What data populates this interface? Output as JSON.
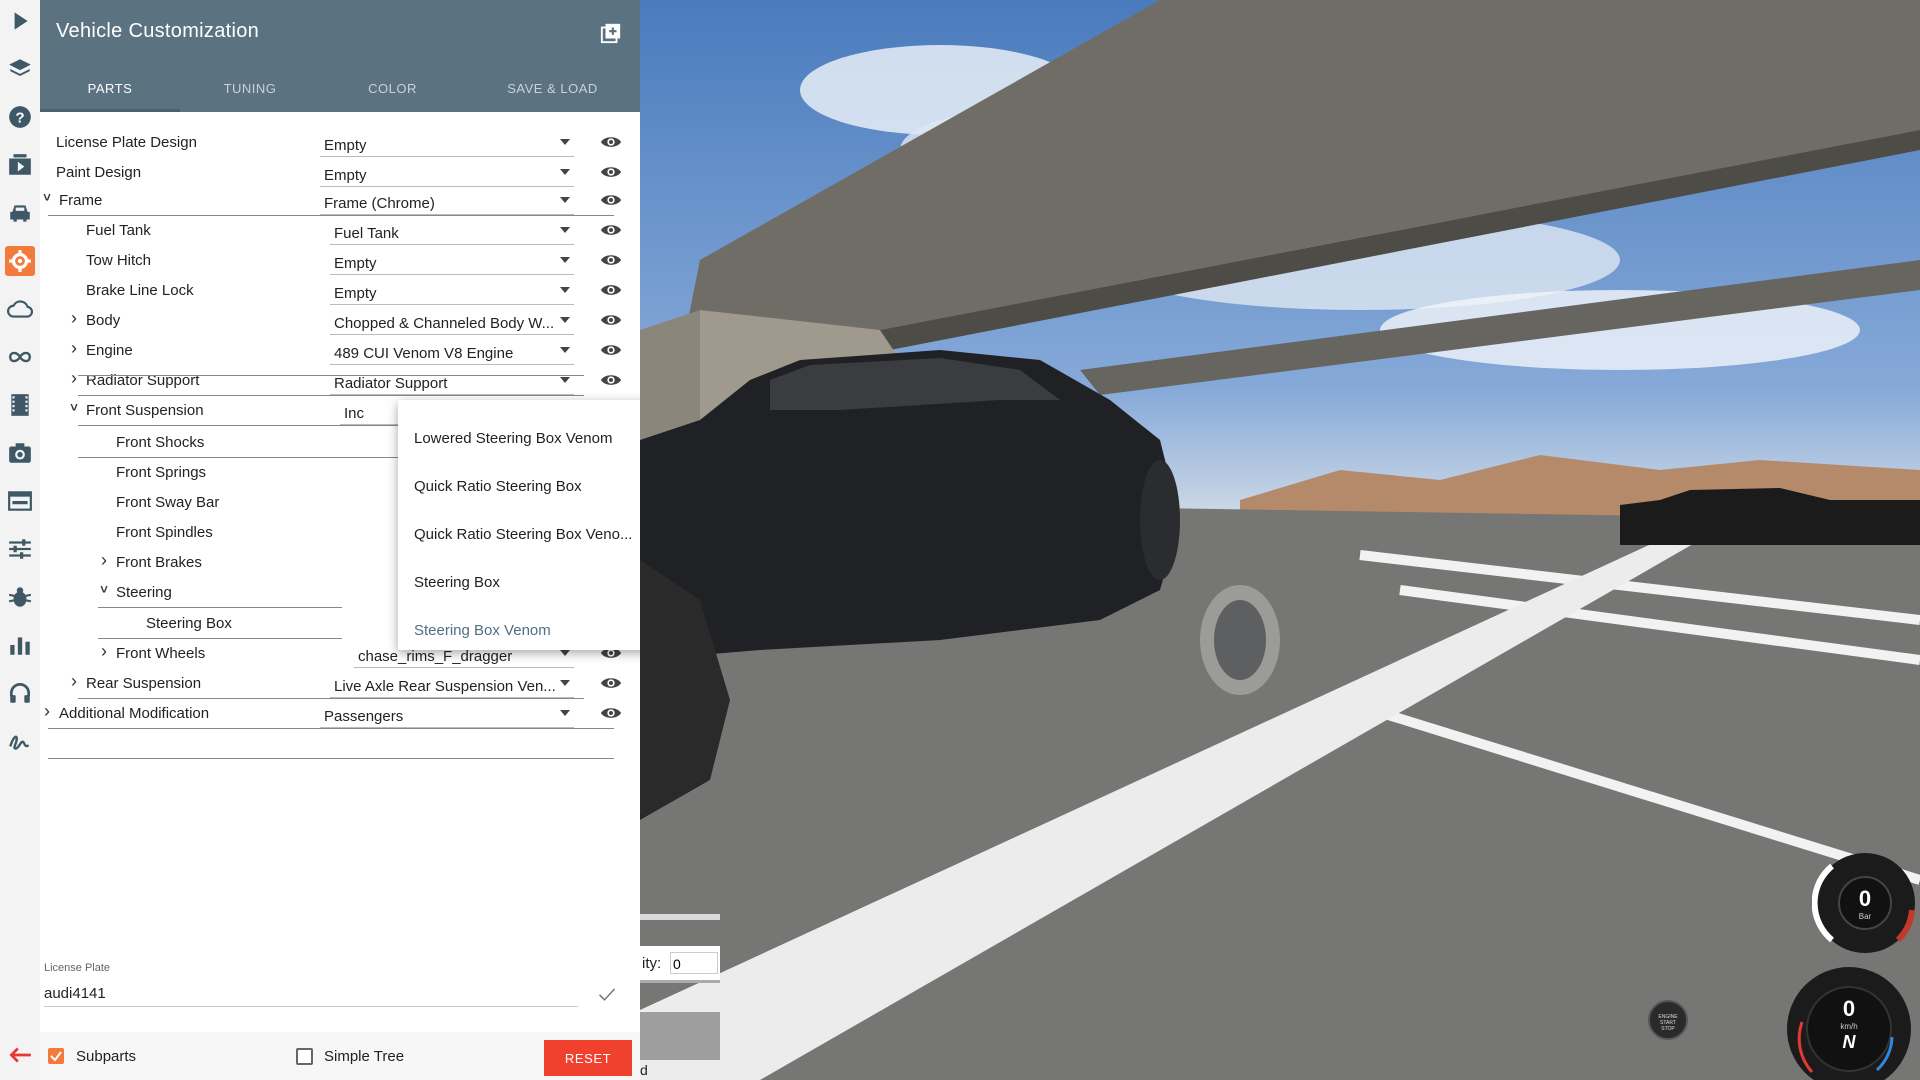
{
  "sidebar": {
    "icons": [
      "play-icon",
      "layers-icon",
      "help-icon",
      "replay-icon",
      "car-icon",
      "gear-icon",
      "cloud-icon",
      "infinity-icon",
      "film-icon",
      "camera-icon",
      "window-icon",
      "sliders-icon",
      "bug-icon",
      "chart-icon",
      "headset-icon",
      "signature-icon",
      "back-arrow-icon"
    ],
    "active_icon": "gear-icon"
  },
  "header": {
    "title": "Vehicle Customization",
    "tabs": [
      {
        "label": "PARTS",
        "active": true
      },
      {
        "label": "TUNING",
        "active": false
      },
      {
        "label": "COLOR",
        "active": false
      },
      {
        "label": "SAVE & LOAD",
        "active": false
      }
    ]
  },
  "parts": [
    {
      "name": "License Plate Design",
      "value": "Empty",
      "level": 0,
      "expander": "none"
    },
    {
      "name": "Paint Design",
      "value": "Empty",
      "level": 0,
      "expander": "none"
    },
    {
      "name": "Frame",
      "value": "Frame (Chrome)",
      "level": 0,
      "expander": "open"
    },
    {
      "name": "Fuel Tank",
      "value": "Fuel Tank",
      "level": 1,
      "expander": "none"
    },
    {
      "name": "Tow Hitch",
      "value": "Empty",
      "level": 1,
      "expander": "none"
    },
    {
      "name": "Brake Line Lock",
      "value": "Empty",
      "level": 1,
      "expander": "none"
    },
    {
      "name": "Body",
      "value": "Chopped & Channeled Body W...",
      "level": 1,
      "expander": "closed"
    },
    {
      "name": "Engine",
      "value": "489 CUI Venom V8 Engine",
      "level": 1,
      "expander": "closed"
    },
    {
      "name": "Radiator Support",
      "value": "Radiator Support",
      "level": 1,
      "expander": "closed"
    },
    {
      "name": "Front Suspension",
      "value": "Inc",
      "level": 1,
      "expander": "open"
    },
    {
      "name": "Front Shocks",
      "value": "",
      "level": 2,
      "expander": "none"
    },
    {
      "name": "Front Springs",
      "value": "",
      "level": 2,
      "expander": "none"
    },
    {
      "name": "Front Sway Bar",
      "value": "",
      "level": 2,
      "expander": "none"
    },
    {
      "name": "Front Spindles",
      "value": "",
      "level": 2,
      "expander": "none"
    },
    {
      "name": "Front Brakes",
      "value": "",
      "level": 2,
      "expander": "closed"
    },
    {
      "name": "Steering",
      "value": "",
      "level": 2,
      "expander": "open"
    },
    {
      "name": "Steering Box",
      "value": "",
      "level": 3,
      "expander": "none"
    },
    {
      "name": "Front Wheels",
      "value": "chase_rims_F_dragger",
      "level": 2,
      "expander": "closed"
    },
    {
      "name": "Rear Suspension",
      "value": "Live Axle Rear Suspension Ven...",
      "level": 1,
      "expander": "closed"
    },
    {
      "name": "Additional Modification",
      "value": "Passengers",
      "level": 0,
      "expander": "closed"
    }
  ],
  "dropdown": {
    "options": [
      {
        "label": "Lowered Steering Box Venom",
        "selected": false
      },
      {
        "label": "Quick Ratio Steering Box",
        "selected": false
      },
      {
        "label": "Quick Ratio Steering Box Veno...",
        "selected": false
      },
      {
        "label": "Steering Box",
        "selected": false
      },
      {
        "label": "Steering Box Venom",
        "selected": true
      }
    ]
  },
  "license_plate": {
    "label": "License Plate",
    "value": "audi4141"
  },
  "footer": {
    "subparts_label": "Subparts",
    "subparts_checked": true,
    "simple_tree_label": "Simple Tree",
    "simple_tree_checked": false,
    "reset_label": "RESET"
  },
  "game_fragment": {
    "field_label": "ity:",
    "field_value": "0",
    "trailing_char": "d"
  },
  "dashboard": {
    "gear_gauge_value": "0",
    "gear_gauge_unit": "Bar",
    "speed_value": "0",
    "speed_unit": "km/h",
    "gear_display": "N",
    "engine_button_lines": [
      "ENGINE",
      "START",
      "STOP"
    ]
  },
  "colors": {
    "header_bg": "#5b7280",
    "accent_orange": "#f27a3a",
    "reset_red": "#f0412f",
    "selected_option": "#4f6f82"
  }
}
